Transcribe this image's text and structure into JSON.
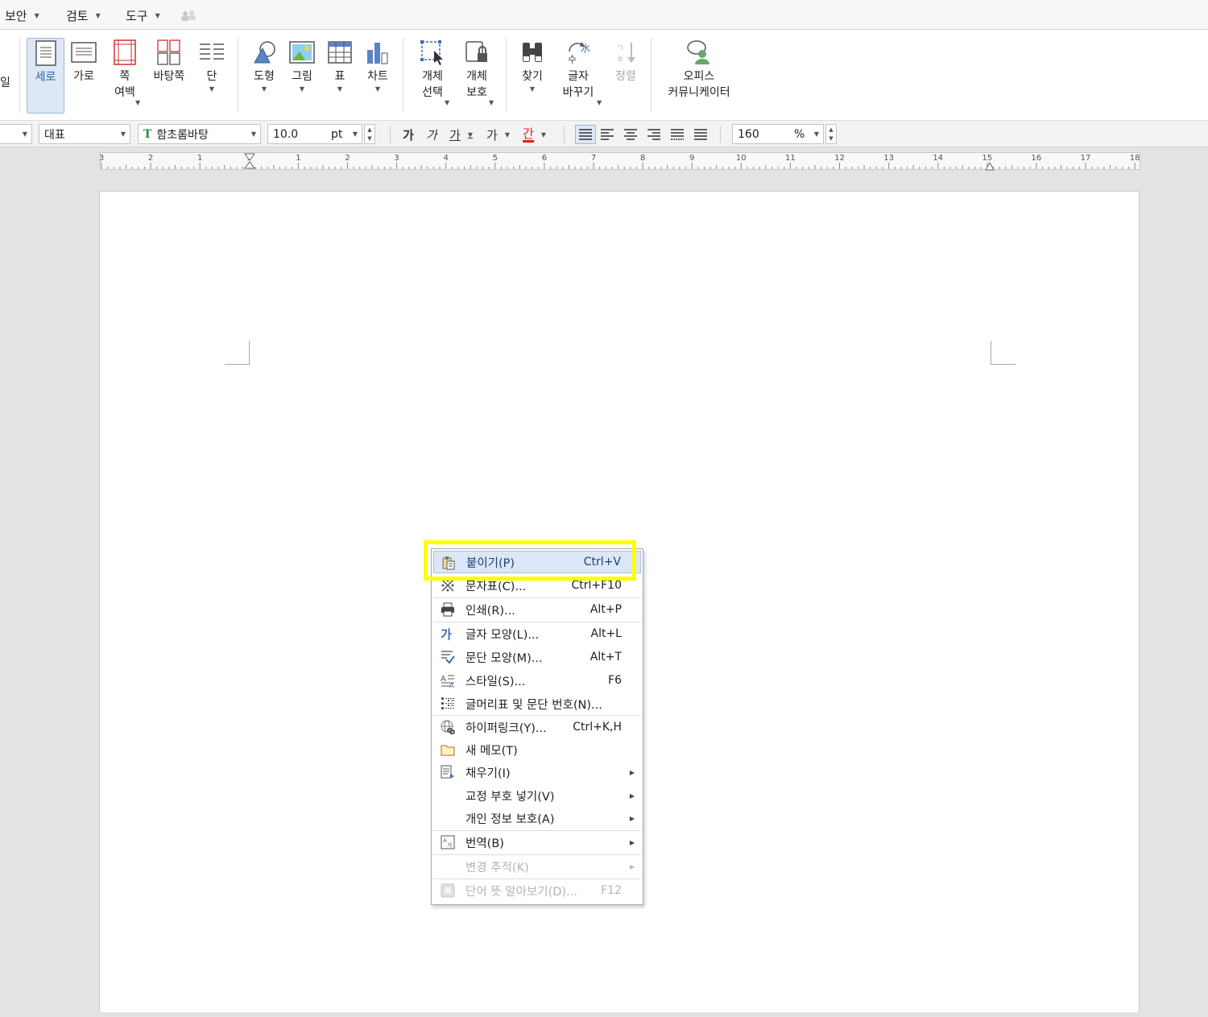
{
  "menubar": {
    "items": [
      {
        "label": "보안"
      },
      {
        "label": "검토"
      },
      {
        "label": "도구"
      }
    ]
  },
  "ribbon": {
    "left_edge_label": "일",
    "buttons": [
      {
        "label": "세로",
        "icon": "portrait-page-icon",
        "active": true
      },
      {
        "label": "가로",
        "icon": "landscape-page-icon"
      },
      {
        "label": "쪽\n여백",
        "icon": "page-margin-icon",
        "dropdown": true
      },
      {
        "label": "바탕쪽",
        "icon": "master-page-icon"
      },
      {
        "label": "단",
        "icon": "columns-icon",
        "dropdown": true
      },
      {
        "label": "도형",
        "icon": "shape-icon",
        "dropdown": true
      },
      {
        "label": "그림",
        "icon": "picture-icon",
        "dropdown": true
      },
      {
        "label": "표",
        "icon": "table-icon",
        "dropdown": true
      },
      {
        "label": "차트",
        "icon": "chart-icon",
        "dropdown": true
      },
      {
        "label": "개체\n선택",
        "icon": "select-object-icon",
        "dropdown": true
      },
      {
        "label": "개체\n보호",
        "icon": "protect-object-icon",
        "dropdown": true
      },
      {
        "label": "찾기",
        "icon": "binoculars-icon",
        "dropdown": true
      },
      {
        "label": "글자\n바꾸기",
        "icon": "replace-text-icon",
        "dropdown": true
      },
      {
        "label": "정렬",
        "icon": "sort-icon",
        "disabled": true
      },
      {
        "label": "오피스\n커뮤니케이터",
        "icon": "office-communicator-icon"
      }
    ]
  },
  "format": {
    "style_left_value": "",
    "style_value": "대표",
    "font_value": "함초롬바탕",
    "font_badge": "T",
    "size_value": "10.0",
    "size_unit": "pt",
    "bold_label": "가",
    "italic_label": "가",
    "underline_label": "가",
    "strike_label": "가",
    "color_label": "간",
    "zoom_value": "160",
    "zoom_unit": "%"
  },
  "ruler": {
    "numbers": [
      "3",
      "2",
      "1",
      "1",
      "1",
      "2",
      "3",
      "4",
      "5",
      "6",
      "7",
      "8",
      "9",
      "10",
      "11",
      "12",
      "13",
      "14",
      "15",
      "16",
      "17",
      "18"
    ]
  },
  "context_menu": {
    "items": [
      {
        "label": "붙이기(P)",
        "shortcut": "Ctrl+V",
        "icon": "paste-icon",
        "highlighted": true
      },
      {
        "label": "문자표(C)...",
        "shortcut": "Ctrl+F10",
        "icon": "symbol-icon"
      },
      {
        "label": "인쇄(R)...",
        "shortcut": "Alt+P",
        "icon": "printer-icon"
      },
      {
        "label": "글자 모양(L)...",
        "shortcut": "Alt+L",
        "icon": "char-shape-icon"
      },
      {
        "label": "문단 모양(M)...",
        "shortcut": "Alt+T",
        "icon": "paragraph-shape-icon"
      },
      {
        "label": "스타일(S)...",
        "shortcut": "F6",
        "icon": "style-icon"
      },
      {
        "label": "글머리표 및 문단 번호(N)...",
        "shortcut": "",
        "icon": "bullets-icon"
      },
      {
        "label": "하이퍼링크(Y)...",
        "shortcut": "Ctrl+K,H",
        "icon": "hyperlink-icon"
      },
      {
        "label": "새 메모(T)",
        "shortcut": "",
        "icon": "memo-icon"
      },
      {
        "label": "채우기(I)",
        "shortcut": "",
        "icon": "fill-icon",
        "submenu": true
      },
      {
        "label": "교정 부호 넣기(V)",
        "shortcut": "",
        "icon": "",
        "submenu": true
      },
      {
        "label": "개인 정보 보호(A)",
        "shortcut": "",
        "icon": "",
        "submenu": true
      },
      {
        "label": "번역(B)",
        "shortcut": "",
        "icon": "translate-icon",
        "submenu": true
      },
      {
        "label": "변경 추적(K)",
        "shortcut": "",
        "icon": "",
        "submenu": true,
        "disabled": true
      },
      {
        "label": "단어 뜻 알아보기(D)...",
        "shortcut": "F12",
        "icon": "dictionary-icon",
        "disabled": true
      }
    ]
  },
  "colors": {
    "highlight_box": "#ffff00",
    "menu_highlight": "#dbe7f7",
    "ribbon_active": "#dde8f6",
    "font_color_underline": "#e02020"
  }
}
